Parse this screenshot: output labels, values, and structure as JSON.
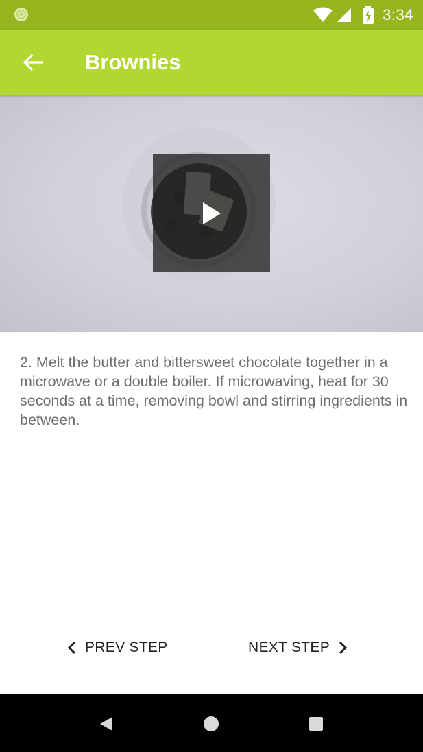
{
  "status_bar": {
    "time": "3:34",
    "icons": [
      "app-notification-icon",
      "wifi-icon",
      "cell-signal-icon",
      "battery-charging-icon"
    ]
  },
  "app_bar": {
    "title": "Brownies",
    "back_icon": "arrow-back-icon"
  },
  "video": {
    "play_icon": "play-icon"
  },
  "step": {
    "description": "2. Melt the butter and bittersweet chocolate together in a microwave or a double boiler. If microwaving, heat for 30 seconds at a time, removing bowl and stirring ingredients in between."
  },
  "navigation": {
    "prev_label": "PREV STEP",
    "next_label": "NEXT STEP"
  },
  "system_nav": {
    "icons": [
      "nav-back-icon",
      "nav-home-icon",
      "nav-recents-icon"
    ]
  },
  "colors": {
    "status_bar": "#97b61e",
    "app_bar": "#b2d733",
    "step_text": "#6f6f6f",
    "button_text": "#222222"
  }
}
